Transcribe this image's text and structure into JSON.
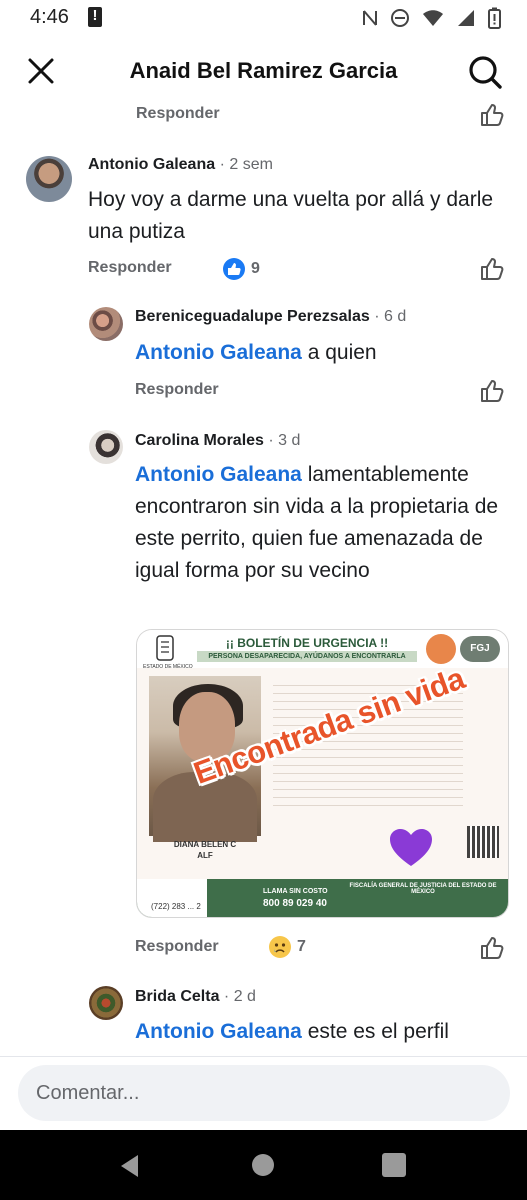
{
  "status_bar": {
    "time": "4:46",
    "alert_glyph": "!",
    "icons": [
      "nfc-icon",
      "do-not-disturb-icon",
      "wifi-icon",
      "signal-icon",
      "battery-icon"
    ]
  },
  "header": {
    "title": "Anaid Bel Ramirez Garcia",
    "close_icon": "close-icon",
    "search_icon": "search-icon"
  },
  "actions": {
    "reply_label": "Responder"
  },
  "comments": [
    {
      "author": "Antonio Galeana",
      "time": "· 2 sem",
      "text": "Hoy voy a darme una vuelta por allá y darle una putiza",
      "reaction": {
        "type": "like",
        "count": "9"
      }
    },
    {
      "author": "Bereniceguadalupe Perezsalas",
      "time": "· 6 d",
      "mention": "Antonio Galeana",
      "text": " a quien"
    },
    {
      "author": "Carolina Morales",
      "time": "· 3 d",
      "mention": "Antonio Galeana",
      "text": " lamentablemente encontraron sin vida a la propietaria de este perrito, quien fue amenazada de igual forma por su vecino",
      "reaction": {
        "type": "sad",
        "count": "7"
      }
    },
    {
      "author": "Brida Celta",
      "time": "· 2 d",
      "mention": "Antonio Galeana",
      "text": " este es el perfil"
    }
  ],
  "poster": {
    "title": "¡¡ BOLETÍN DE URGENCIA !!",
    "subtitle": "PERSONA DESAPARECIDA, AYÚDANOS A ENCONTRARLA",
    "agency_badge": "FGJ",
    "state_label": "ESTADO DE MÉXICO",
    "name_line1": "DIANA BELEN C",
    "name_line2": "ALF",
    "stamp": "Encontrada sin vida",
    "no_cost": "LLAMA SIN COSTO",
    "phone": "800 89 029 40",
    "phone_small": "(722) 283 ... 2",
    "footer_title": "FISCALÍA GENERAL DE JUSTICIA DEL ESTADO DE MÉXICO"
  },
  "composer": {
    "placeholder": "Comentar..."
  },
  "colors": {
    "mention": "#1a6ed8",
    "secondary_text": "#65676b",
    "like_blue": "#1a7af4",
    "stamp_orange": "#e8542a"
  }
}
